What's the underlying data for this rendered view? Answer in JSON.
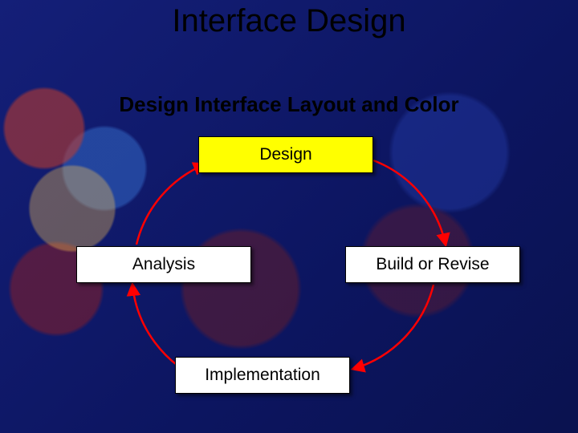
{
  "title": "Interface Design",
  "subtitle": "Design Interface Layout and Color",
  "boxes": {
    "design": "Design",
    "analysis": "Analysis",
    "build": "Build or Revise",
    "implementation": "Implementation"
  },
  "colors": {
    "slide_bg": "#0f1a6b",
    "highlight": "#ffff00",
    "arrow": "#ff0000"
  }
}
